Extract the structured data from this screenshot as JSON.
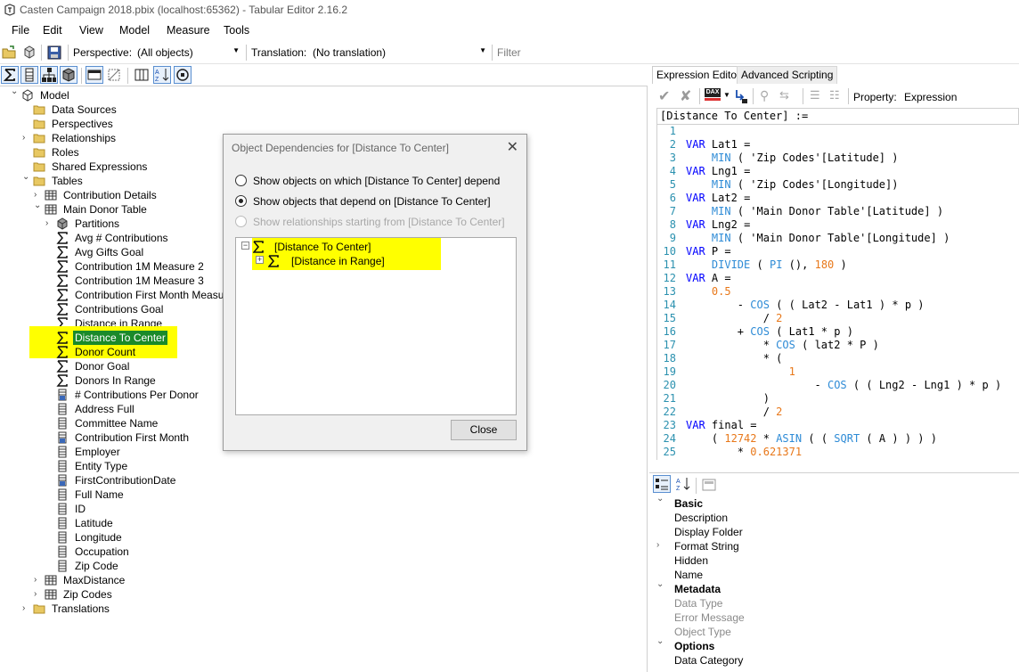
{
  "window": {
    "title": "Casten Campaign 2018.pbix (localhost:65362) - Tabular Editor 2.16.2"
  },
  "menu": [
    "File",
    "Edit",
    "View",
    "Model",
    "Measure",
    "Tools"
  ],
  "toolbar": {
    "perspective_label": "Perspective:",
    "perspective_value": "(All objects)",
    "translation_label": "Translation:",
    "translation_value": "(No translation)",
    "filter_placeholder": "Filter"
  },
  "tree": {
    "nodes": [
      {
        "label": "Model",
        "icon": "model-icon",
        "level": 0,
        "exp": "open"
      },
      {
        "label": "Data Sources",
        "icon": "folder-icon",
        "level": 1,
        "exp": "none"
      },
      {
        "label": "Perspectives",
        "icon": "folder-icon",
        "level": 1,
        "exp": "none"
      },
      {
        "label": "Relationships",
        "icon": "folder-icon",
        "level": 1,
        "exp": "closed"
      },
      {
        "label": "Roles",
        "icon": "folder-icon",
        "level": 1,
        "exp": "none"
      },
      {
        "label": "Shared Expressions",
        "icon": "folder-icon",
        "level": 1,
        "exp": "none"
      },
      {
        "label": "Tables",
        "icon": "folder-icon",
        "level": 1,
        "exp": "open"
      },
      {
        "label": "Contribution Details",
        "icon": "table-icon",
        "level": 2,
        "exp": "closed"
      },
      {
        "label": "Main Donor Table",
        "icon": "table-icon",
        "level": 2,
        "exp": "open"
      },
      {
        "label": "Partitions",
        "icon": "partition-icon",
        "level": 3,
        "exp": "closed"
      },
      {
        "label": "Avg # Contributions",
        "icon": "measure-icon",
        "level": 3,
        "exp": "none"
      },
      {
        "label": "Avg Gifts Goal",
        "icon": "measure-icon",
        "level": 3,
        "exp": "none"
      },
      {
        "label": "Contribution 1M Measure 2",
        "icon": "measure-icon",
        "level": 3,
        "exp": "none"
      },
      {
        "label": "Contribution 1M Measure 3",
        "icon": "measure-icon",
        "level": 3,
        "exp": "none"
      },
      {
        "label": "Contribution First Month Measure",
        "icon": "measure-icon",
        "level": 3,
        "exp": "none"
      },
      {
        "label": "Contributions Goal",
        "icon": "measure-icon",
        "level": 3,
        "exp": "none"
      },
      {
        "label": "Distance in Range",
        "icon": "measure-icon",
        "level": 3,
        "exp": "none"
      },
      {
        "label": "Distance To Center",
        "icon": "measure-icon",
        "level": 3,
        "exp": "none",
        "selected": true
      },
      {
        "label": "Donor Count",
        "icon": "measure-icon",
        "level": 3,
        "exp": "none"
      },
      {
        "label": "Donor Goal",
        "icon": "measure-icon",
        "level": 3,
        "exp": "none"
      },
      {
        "label": "Donors In Range",
        "icon": "measure-icon",
        "level": 3,
        "exp": "none"
      },
      {
        "label": "# Contributions Per Donor",
        "icon": "calc-column-icon",
        "level": 3,
        "exp": "none"
      },
      {
        "label": "Address Full",
        "icon": "column-icon",
        "level": 3,
        "exp": "none"
      },
      {
        "label": "Committee Name",
        "icon": "column-icon",
        "level": 3,
        "exp": "none"
      },
      {
        "label": "Contribution First Month",
        "icon": "calc-column-icon",
        "level": 3,
        "exp": "none"
      },
      {
        "label": "Employer",
        "icon": "column-icon",
        "level": 3,
        "exp": "none"
      },
      {
        "label": "Entity Type",
        "icon": "column-icon",
        "level": 3,
        "exp": "none"
      },
      {
        "label": "FirstContributionDate",
        "icon": "calc-column-icon",
        "level": 3,
        "exp": "none"
      },
      {
        "label": "Full Name",
        "icon": "column-icon",
        "level": 3,
        "exp": "none"
      },
      {
        "label": "ID",
        "icon": "column-icon",
        "level": 3,
        "exp": "none"
      },
      {
        "label": "Latitude",
        "icon": "column-icon",
        "level": 3,
        "exp": "none"
      },
      {
        "label": "Longitude",
        "icon": "column-icon",
        "level": 3,
        "exp": "none"
      },
      {
        "label": "Occupation",
        "icon": "column-icon",
        "level": 3,
        "exp": "none"
      },
      {
        "label": "Zip Code",
        "icon": "column-icon",
        "level": 3,
        "exp": "none"
      },
      {
        "label": "MaxDistance",
        "icon": "table-icon",
        "level": 2,
        "exp": "closed"
      },
      {
        "label": "Zip Codes",
        "icon": "table-icon",
        "level": 2,
        "exp": "closed"
      },
      {
        "label": "Translations",
        "icon": "folder-icon",
        "level": 1,
        "exp": "closed"
      }
    ]
  },
  "dialog": {
    "title": "Object Dependencies for [Distance To Center]",
    "options": [
      {
        "label": "Show objects on which [Distance To Center] depend",
        "checked": false,
        "disabled": false
      },
      {
        "label": "Show objects that depend on [Distance To Center]",
        "checked": true,
        "disabled": false
      },
      {
        "label": "Show relationships starting from [Distance To Center]",
        "checked": false,
        "disabled": true
      }
    ],
    "dep_tree": [
      {
        "label": "[Distance To Center]",
        "exp": "open"
      },
      {
        "label": "[Distance in Range]",
        "exp": "closed"
      }
    ],
    "close_label": "Close"
  },
  "editor": {
    "tabs": [
      "Expression Editor",
      "Advanced Scripting"
    ],
    "dax_badge": "DAX",
    "property_label": "Property:",
    "property_value": "Expression",
    "header": "[Distance To Center] :=",
    "lines": [
      "",
      "VAR Lat1 =",
      "    MIN ( 'Zip Codes'[Latitude] )",
      "VAR Lng1 =",
      "    MIN ( 'Zip Codes'[Longitude])",
      "VAR Lat2 =",
      "    MIN ( 'Main Donor Table'[Latitude] )",
      "VAR Lng2 =",
      "    MIN ( 'Main Donor Table'[Longitude] )",
      "VAR P =",
      "    DIVIDE ( PI (), 180 )",
      "VAR A =",
      "    0.5",
      "        - COS ( ( Lat2 - Lat1 ) * p )",
      "            / 2",
      "        + COS ( Lat1 * p )",
      "            * COS ( lat2 * P )",
      "            * (",
      "                1",
      "                    - COS ( ( Lng2 - Lng1 ) * p )",
      "            )",
      "            / 2",
      "VAR final =",
      "    ( 12742 * ASIN ( ( SQRT ( A ) ) ) )",
      "        * 0.621371"
    ]
  },
  "properties": {
    "rows": [
      {
        "label": "Basic",
        "type": "cat",
        "exp": "open"
      },
      {
        "label": "Description",
        "type": "prop"
      },
      {
        "label": "Display Folder",
        "type": "prop"
      },
      {
        "label": "Format String",
        "type": "prop",
        "exp": "closed"
      },
      {
        "label": "Hidden",
        "type": "prop"
      },
      {
        "label": "Name",
        "type": "prop"
      },
      {
        "label": "Metadata",
        "type": "cat",
        "exp": "open"
      },
      {
        "label": "Data Type",
        "type": "dim"
      },
      {
        "label": "Error Message",
        "type": "dim"
      },
      {
        "label": "Object Type",
        "type": "dim"
      },
      {
        "label": "Options",
        "type": "cat",
        "exp": "open"
      },
      {
        "label": "Data Category",
        "type": "prop"
      }
    ]
  },
  "colors": {
    "highlight": "#ffff00",
    "selection": "#1a8a2a",
    "keyword": "#0000ff",
    "function": "#2e8bd6",
    "number": "#e8781a",
    "line_number": "#2b91af"
  }
}
